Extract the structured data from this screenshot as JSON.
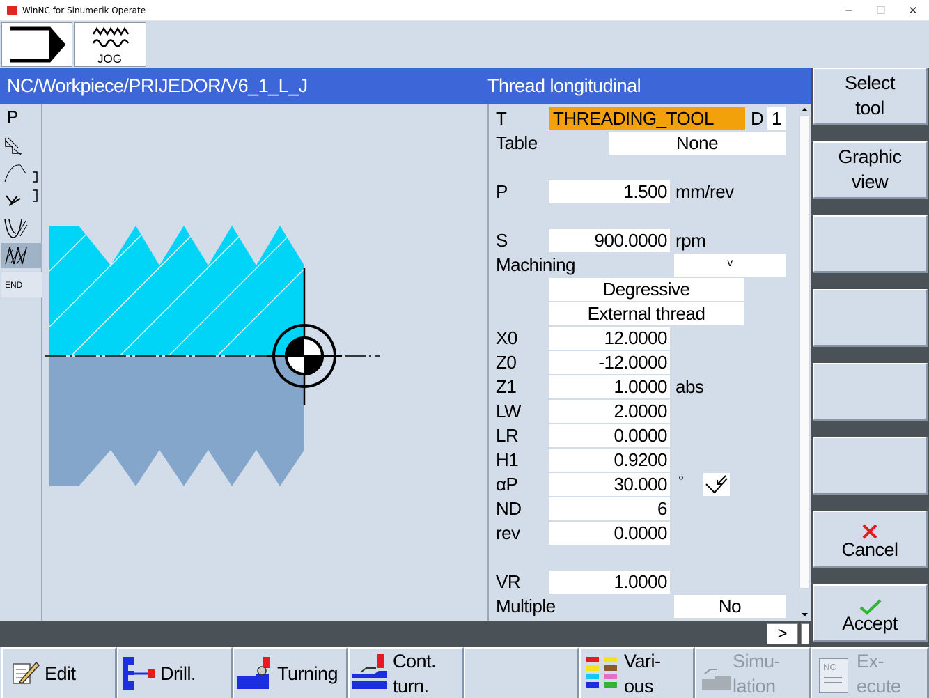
{
  "window": {
    "title": "WinNC for Sinumerik Operate",
    "minimize": "─",
    "maximize": "☐",
    "close": "✕"
  },
  "mode": {
    "jog_label": "JOG"
  },
  "header": {
    "path": "NC/Workpiece/PRIJEDOR/V6_1_L_J",
    "cycle_title": "Thread longitudinal"
  },
  "left_strip": {
    "p_label": "P",
    "end_label": "END"
  },
  "params": {
    "t_label": "T",
    "tool_name": "THREADING_TOOL",
    "d_label": "D",
    "d_value": "1",
    "table_label": "Table",
    "table_value": "None",
    "p_label": "P",
    "p_value": "1.500",
    "p_unit": "mm/rev",
    "s_label": "S",
    "s_value": "900.0000",
    "s_unit": "rpm",
    "machining_label": "Machining",
    "machining_value": "v",
    "mode1": "Degressive",
    "mode2": "External thread",
    "x0_label": "X0",
    "x0_value": "12.0000",
    "z0_label": "Z0",
    "z0_value": "-12.0000",
    "z1_label": "Z1",
    "z1_value": "1.0000",
    "z1_unit": "abs",
    "lw_label": "LW",
    "lw_value": "2.0000",
    "lr_label": "LR",
    "lr_value": "0.0000",
    "h1_label": "H1",
    "h1_value": "0.9200",
    "ap_label": "αP",
    "ap_value": "30.000",
    "ap_unit": "°",
    "nd_label": "ND",
    "nd_value": "6",
    "rev_label": "rev",
    "rev_value": "0.0000",
    "vr_label": "VR",
    "vr_value": "1.0000",
    "multiple_label": "Multiple",
    "multiple_value": "No"
  },
  "statusbar": {
    "more_label": ">"
  },
  "vertical_softkeys": {
    "select_tool_1": "Select",
    "select_tool_2": "tool",
    "graphic_view_1": "Graphic",
    "graphic_view_2": "view",
    "cancel": "Cancel",
    "accept": "Accept"
  },
  "horizontal_softkeys": {
    "edit": "Edit",
    "drill": "Drill.",
    "turning": "Turning",
    "cont_turn_1": "Cont.",
    "cont_turn_2": "turn.",
    "various_1": "Vari-",
    "various_2": "ous",
    "simulation_1": "Simu-",
    "simulation_2": "lation",
    "execute_1": "Ex-",
    "execute_2": "ecute",
    "nc_badge": "NC"
  },
  "colors": {
    "header_blue": "#3d66d9",
    "tool_field_orange": "#f2a10b",
    "thread_cyan": "#00d4f7",
    "workpiece_blue": "#84a6cb",
    "cancel_red": "#e8191f",
    "accept_green": "#2fb52f"
  },
  "icons": [
    "program-arrow-icon",
    "jog-icon",
    "edit-icon",
    "drill-icon",
    "turning-icon",
    "contour-turning-icon",
    "various-icon",
    "simulation-icon",
    "execute-icon",
    "cancel-icon",
    "accept-icon",
    "thread-direction-icon"
  ]
}
